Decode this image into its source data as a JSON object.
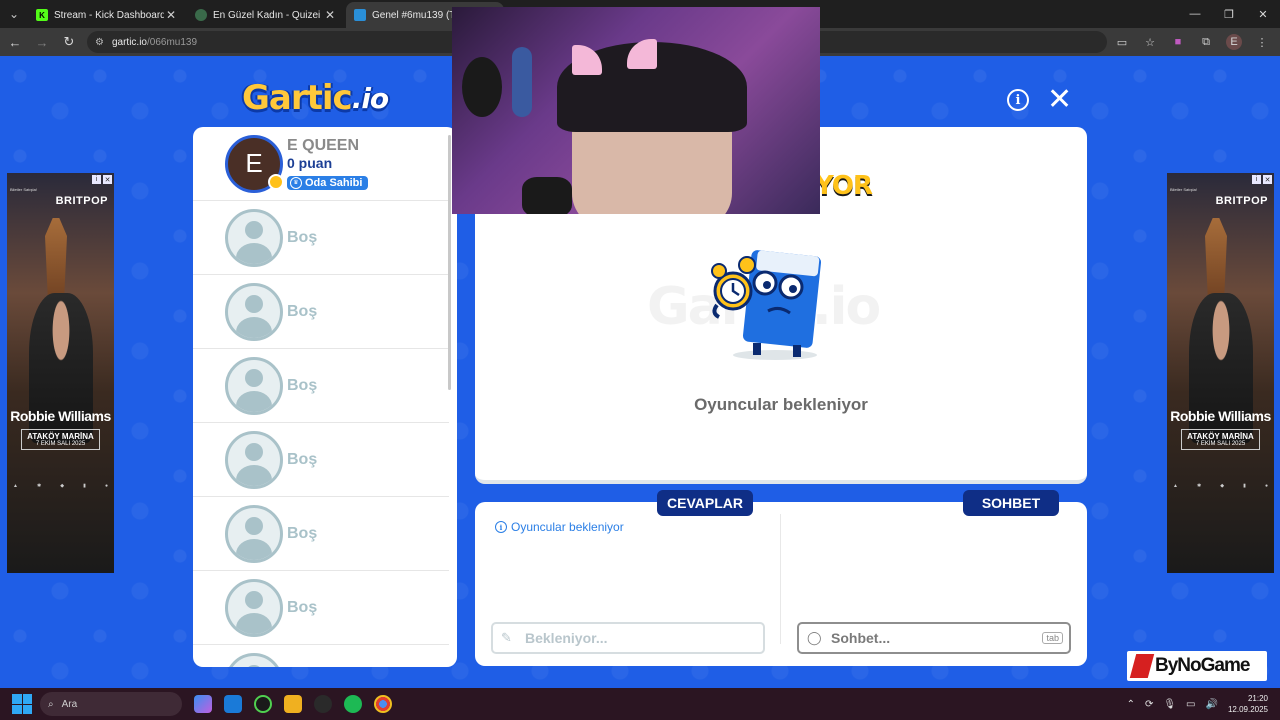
{
  "browser": {
    "tabs": [
      {
        "title": "Stream - Kick Dashboard",
        "favicon": "K",
        "favicon_color": "#53fc18",
        "active": false
      },
      {
        "title": "En Güzel Kadın - Quizei",
        "favicon": "",
        "favicon_color": "#3a6a4a",
        "active": false
      },
      {
        "title": "Genel #6mu139 (Türkçe)",
        "favicon": "",
        "favicon_color": "#2a8fd8",
        "active": true
      }
    ],
    "url_domain": "gartic.io",
    "url_path": "/066mu139",
    "profile_initial": "E"
  },
  "header": {
    "logo_main": "Gartic",
    "logo_ext": ".io"
  },
  "players": {
    "host": {
      "initial": "E",
      "name": "E QUEEN",
      "points": "0 puan",
      "badge": "Oda Sahibi"
    },
    "empty_label": "Boş",
    "empty_slots": [
      "Boş",
      "Boş",
      "Boş",
      "Boş",
      "Boş",
      "Boş"
    ]
  },
  "main": {
    "title_partial": "YOR",
    "watermark": "Gartic.io",
    "waiting_message": "Oyuncular bekleniyor"
  },
  "answers": {
    "label": "CEVAPLAR",
    "status": "Oyuncular bekleniyor",
    "placeholder": "Bekleniyor..."
  },
  "chat": {
    "label": "SOHBET",
    "placeholder": "Sohbet...",
    "key_hint": "tab"
  },
  "ads": {
    "sponsor_text": "Biletler Satışta!",
    "brand": "BRITPOP",
    "artist": "Robbie Williams",
    "venue": "ATAKÖY MARİNA",
    "date": "7 EKİM SALI 2025"
  },
  "overlay": {
    "logo_text": "ByNoGame"
  },
  "taskbar": {
    "search_placeholder": "Ara",
    "time": "21:20",
    "date": "12.09.2025"
  },
  "colors": {
    "page_bg": "#1f5ee6",
    "badge_navy": "#0f2e86",
    "accent_yellow": "#ffc21a",
    "link_blue": "#2b7fe6"
  }
}
